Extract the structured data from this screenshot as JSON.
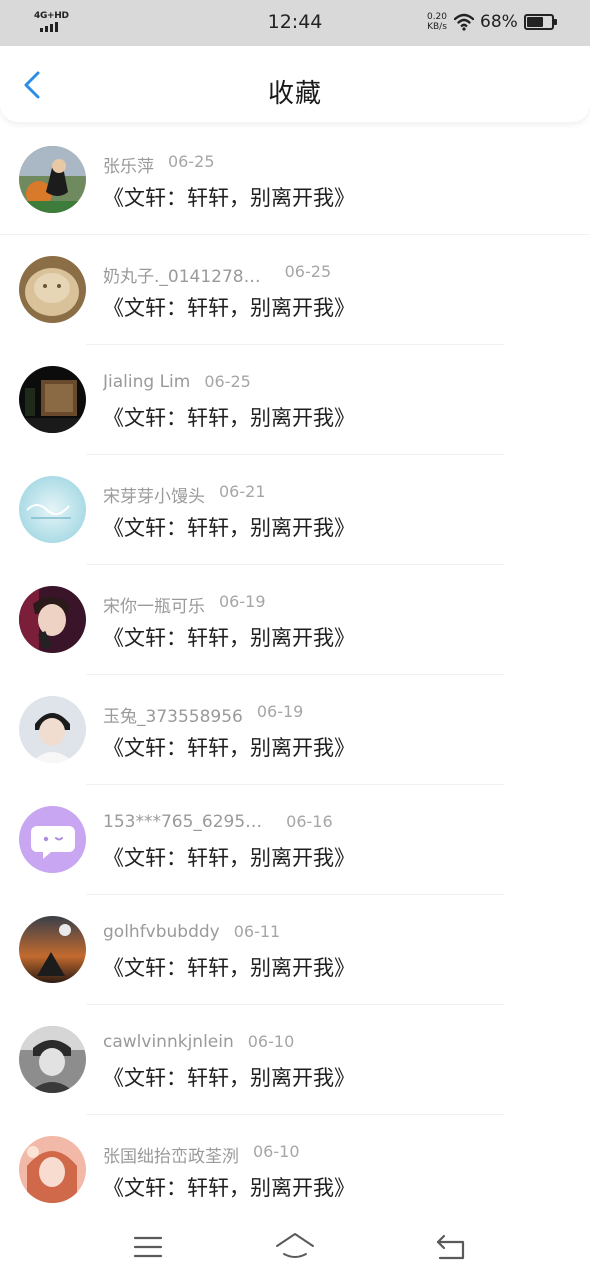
{
  "status_bar": {
    "network": "4G+HD",
    "time": "12:44",
    "speed_value": "0.20",
    "speed_unit": "KB/s",
    "battery_percent": "68%",
    "battery_level": 0.68
  },
  "header": {
    "title": "收藏",
    "back_icon": "chevron-left-icon",
    "accent_color": "#2a8ee6"
  },
  "favorites": [
    {
      "name": "张乐萍",
      "date": "06-25",
      "content": "《文轩：轩轩，别离开我》"
    },
    {
      "name": "奶丸子._0141278…",
      "date": "06-25",
      "content": "《文轩：轩轩，别离开我》"
    },
    {
      "name": "Jialing Lim",
      "date": "06-25",
      "content": "《文轩：轩轩，别离开我》"
    },
    {
      "name": "宋芽芽小馒头",
      "date": "06-21",
      "content": "《文轩：轩轩，别离开我》"
    },
    {
      "name": "宋你一瓶可乐",
      "date": "06-19",
      "content": "《文轩：轩轩，别离开我》"
    },
    {
      "name": "玉兔_373558956",
      "date": "06-19",
      "content": "《文轩：轩轩，别离开我》"
    },
    {
      "name": "153***765_6295…",
      "date": "06-16",
      "content": "《文轩：轩轩，别离开我》"
    },
    {
      "name": "golhfvbubddy",
      "date": "06-11",
      "content": "《文轩：轩轩，别离开我》"
    },
    {
      "name": "cawlvinnkjnlein",
      "date": "06-10",
      "content": "《文轩：轩轩，别离开我》"
    },
    {
      "name": "张国绌抬峦政荃洌",
      "date": "06-10",
      "content": "《文轩：轩轩，别离开我》"
    }
  ],
  "nav_bar": {
    "icons": [
      "menu-icon",
      "home-icon",
      "back-icon"
    ]
  }
}
